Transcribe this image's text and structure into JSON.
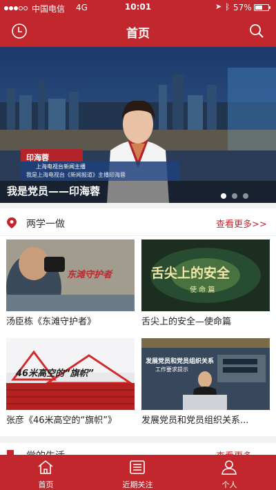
{
  "status_bar": {
    "carrier": "中国电信",
    "network": "4G",
    "time": "10:01",
    "battery_text": "57%",
    "battery_level": 0.57
  },
  "nav": {
    "title": "首页"
  },
  "banner": {
    "caption": "我是党员——印海蓉",
    "tv_name": "印海蓉",
    "tv_role": "上海电视台新闻主播",
    "tv_sub": "我是上海电视台《新闻报道》主播印海蓉",
    "page_count": 3,
    "active_page": 1
  },
  "section_lxyz": {
    "title": "两学一做",
    "more": "查看更多>>",
    "items": [
      {
        "label": "汤臣栋《东滩守护者》",
        "thumb_text": "东滩守护者"
      },
      {
        "label": "舌尖上的安全—使命篇",
        "thumb_text": "舌尖上的安全",
        "thumb_sub": "使 命 篇"
      },
      {
        "label": "张彦《46米高空的“旗帜”》",
        "thumb_text": "46米高空的“旗帜”"
      },
      {
        "label": "发展党员和党员组织关系...",
        "thumb_text": "发展党员和党员组织关系",
        "thumb_sub": "工作要求提示"
      }
    ]
  },
  "next_section": {
    "title": "党的生活",
    "more": "查看更多"
  },
  "tabs": [
    {
      "label": "首页",
      "icon": "home-icon"
    },
    {
      "label": "近期关注",
      "icon": "list-icon"
    },
    {
      "label": "个人",
      "icon": "person-icon"
    }
  ],
  "colors": {
    "brand": "#c1272d",
    "background": "#f2f2f2"
  }
}
